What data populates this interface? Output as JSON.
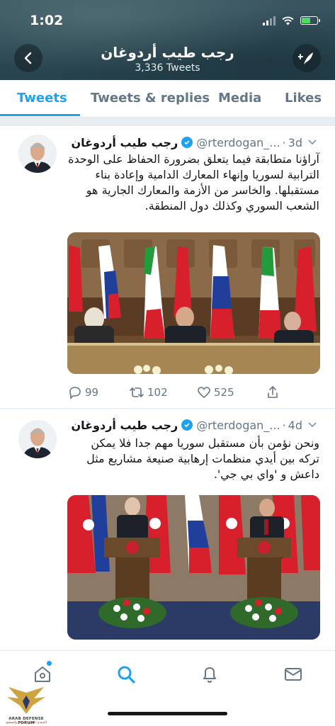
{
  "status_bar": {
    "time": "1:02"
  },
  "header": {
    "title": "رجب طيب أردوغان",
    "subtitle": "3,336 Tweets",
    "back_icon": "chevron-left-icon",
    "compose_icon": "compose-feather-icon"
  },
  "tabs": [
    {
      "label": "Tweets",
      "active": true
    },
    {
      "label": "Tweets & replies",
      "active": false
    },
    {
      "label": "Media",
      "active": false
    },
    {
      "label": "Likes",
      "active": false
    }
  ],
  "accent_color": "#1da1f2",
  "tweets": [
    {
      "name": "رجب طيب أردوغان",
      "handle": "@rterdogan_...",
      "separator": "·",
      "time": "3d",
      "text": "آراؤنا متطابقة فيما يتعلق بضرورة الحفاظ على الوحدة الترابية لسوريا وإنهاء المعارك الدامية وإعادة بناء مستقبلها. والخاسر من الأزمة والمعارك الجارية هو الشعب السوري وكذلك دول المنطقة.",
      "replies": "99",
      "retweets": "102",
      "likes": "525"
    },
    {
      "name": "رجب طيب أردوغان",
      "handle": "@rterdogan_...",
      "separator": "·",
      "time": "4d",
      "text": "ونحن نؤمن بأن مستقبل سوريا مهم جدا فلا يمكن تركه بين أيدي منظمات إرهابية صنيعة مشاريع مثل داعش و 'واي بي جي'."
    }
  ],
  "bottom_nav": [
    {
      "icon": "home-icon",
      "active": false,
      "has_dot": true
    },
    {
      "icon": "search-icon",
      "active": true
    },
    {
      "icon": "bell-icon",
      "active": false
    },
    {
      "icon": "mail-icon",
      "active": false
    }
  ],
  "watermark": {
    "title": "ARAB DEFENSE FORUM",
    "subtitle": "المنتدى العربي للدفاع والتسليح"
  }
}
